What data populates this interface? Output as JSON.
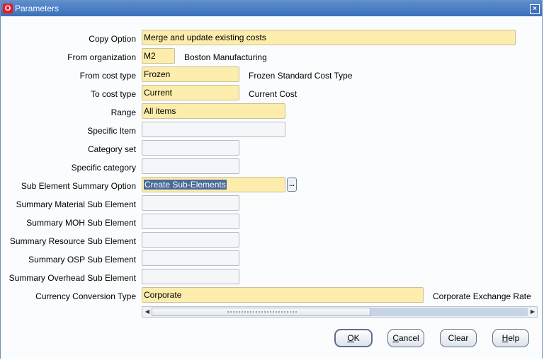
{
  "window": {
    "title": "Parameters",
    "icon": "oracle-o-icon"
  },
  "fields": [
    {
      "label": "Copy Option",
      "value": "Merge and update existing costs",
      "description": ""
    },
    {
      "label": "From organization",
      "value": "M2",
      "description": "Boston Manufacturing"
    },
    {
      "label": "From cost type",
      "value": "Frozen",
      "description": "Frozen Standard Cost Type"
    },
    {
      "label": "To cost type",
      "value": "Current",
      "description": "Current Cost"
    },
    {
      "label": "Range",
      "value": "All items",
      "description": ""
    },
    {
      "label": "Specific Item",
      "value": "",
      "description": ""
    },
    {
      "label": "Category set",
      "value": "",
      "description": ""
    },
    {
      "label": "Specific category",
      "value": "",
      "description": ""
    },
    {
      "label": "Sub Element Summary Option",
      "value": "Create Sub-Elements",
      "description": ""
    },
    {
      "label": "Summary Material Sub Element",
      "value": "",
      "description": ""
    },
    {
      "label": "Summary MOH Sub Element",
      "value": "",
      "description": ""
    },
    {
      "label": "Summary Resource Sub Element",
      "value": "",
      "description": ""
    },
    {
      "label": "Summary OSP Sub Element",
      "value": "",
      "description": ""
    },
    {
      "label": "Summary Overhead Sub Element",
      "value": "",
      "description": ""
    },
    {
      "label": "Currency Conversion Type",
      "value": "Corporate",
      "description": "Corporate Exchange Rate"
    }
  ],
  "lov_button": "...",
  "buttons": {
    "ok": {
      "mnemonic": "O",
      "rest": "K"
    },
    "cancel": {
      "mnemonic": "C",
      "rest": "ancel"
    },
    "clear": {
      "mnemonic": "",
      "rest": "Clear"
    },
    "help": {
      "mnemonic": "H",
      "rest": "elp"
    }
  },
  "colors": {
    "required_field": "#fcedac",
    "title_bar": "#3b6fb9",
    "selection": "#4a6a98"
  }
}
